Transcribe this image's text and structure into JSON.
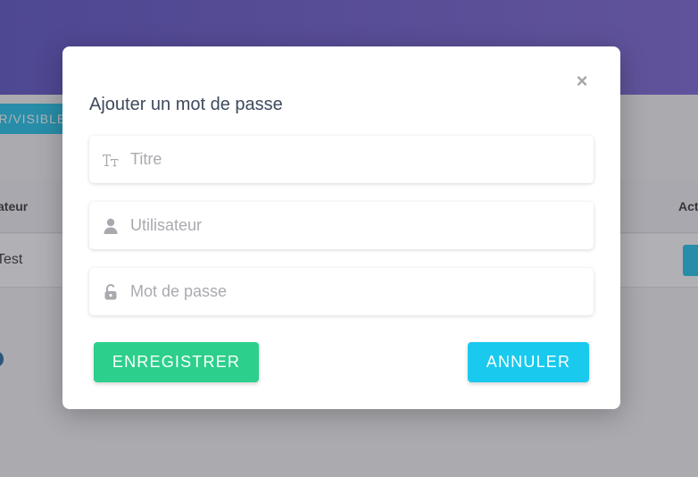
{
  "background": {
    "tab_label": "ER/VISIBLE",
    "table_header_left": "ateur",
    "table_header_right": "Act",
    "table_row_left": "Test"
  },
  "modal": {
    "close_label": "×",
    "title": "Ajouter un mot de passe",
    "fields": [
      {
        "placeholder": "Titre",
        "icon": "text-height-icon"
      },
      {
        "placeholder": "Utilisateur",
        "icon": "user-icon"
      },
      {
        "placeholder": "Mot de passe",
        "icon": "unlock-icon"
      }
    ],
    "save_label": "ENREGISTRER",
    "cancel_label": "ANNULER"
  },
  "colors": {
    "header_gradient": [
      "#5b4fc4",
      "#7a63d4"
    ],
    "save_button": "#2ccf8b",
    "cancel_button": "#19c9ee"
  }
}
